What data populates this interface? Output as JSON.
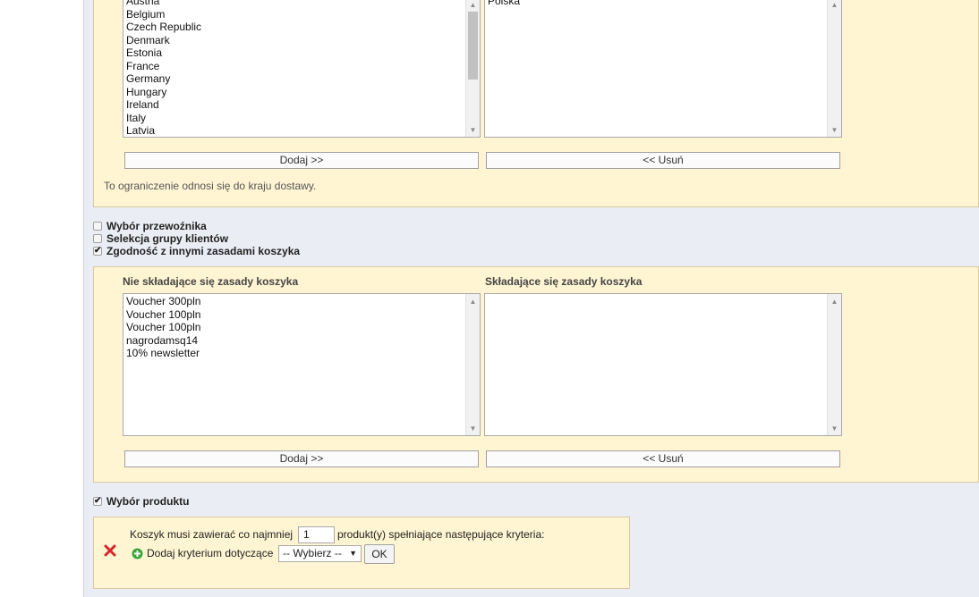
{
  "countries": {
    "available": [
      "Austria",
      "Belgium",
      "Czech Republic",
      "Denmark",
      "Estonia",
      "France",
      "Germany",
      "Hungary",
      "Ireland",
      "Italy",
      "Latvia"
    ],
    "selected": [
      "Polska"
    ],
    "add_label": "Dodaj >>",
    "remove_label": "<< Usuń",
    "note": "To ograniczenie odnosi się do kraju dostawy."
  },
  "options": {
    "carrier": {
      "label": "Wybór przewoźnika",
      "checked": false
    },
    "customer_group": {
      "label": "Selekcja grupy klientów",
      "checked": false
    },
    "compatibility": {
      "label": "Zgodność z innymi zasadami koszyka",
      "checked": true
    }
  },
  "cart_rules": {
    "left_label": "Nie składające się zasady koszyka",
    "right_label": "Składające się zasady koszyka",
    "available": [
      "Voucher 300pln",
      "Voucher 100pln",
      "Voucher 100pln",
      "nagrodamsq14",
      "10% newsletter"
    ],
    "selected": [],
    "add_label": "Dodaj >>",
    "remove_label": "<< Usuń"
  },
  "product_selection": {
    "label": "Wybór produktu",
    "checked": true,
    "text_before": "Koszyk musi zawierać co najmniej",
    "quantity": "1",
    "text_after": "produkt(y) spełniające następujące kryteria:",
    "add_criterion_label": "Dodaj kryterium dotyczące",
    "select_value": "-- Wybierz --",
    "ok_label": "OK"
  },
  "colors": {
    "panel_bg": "#fff5d3",
    "content_bg": "#ebedf4",
    "delete_red": "#d9262b",
    "add_green": "#3aa53a"
  }
}
